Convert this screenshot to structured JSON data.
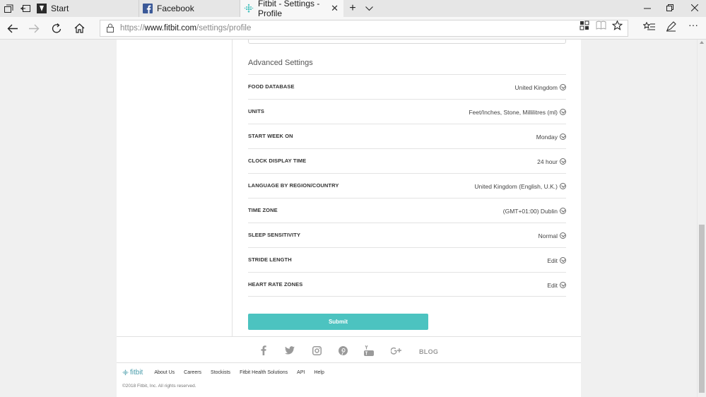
{
  "browser": {
    "tabs": [
      {
        "label": "Start",
        "icon": "start-icon"
      },
      {
        "label": "Facebook",
        "icon": "facebook-icon"
      },
      {
        "label": "Fitbit - Settings - Profile",
        "icon": "fitbit-icon",
        "active": true
      }
    ],
    "url": {
      "scheme": "https://",
      "host": "www.fitbit.com",
      "path": "/settings/profile"
    }
  },
  "section_title": "Advanced Settings",
  "settings": [
    {
      "label": "FOOD DATABASE",
      "value": "United Kingdom"
    },
    {
      "label": "UNITS",
      "value": "Feet/Inches, Stone, Millilitres (ml)"
    },
    {
      "label": "START WEEK ON",
      "value": "Monday"
    },
    {
      "label": "CLOCK DISPLAY TIME",
      "value": "24 hour"
    },
    {
      "label": "LANGUAGE BY REGION/COUNTRY",
      "value": "United Kingdom (English, U.K.)"
    },
    {
      "label": "TIME ZONE",
      "value": "(GMT+01:00) Dublin"
    },
    {
      "label": "SLEEP SENSITIVITY",
      "value": "Normal"
    },
    {
      "label": "STRIDE LENGTH",
      "value": "Edit"
    },
    {
      "label": "HEART RATE ZONES",
      "value": "Edit"
    }
  ],
  "submit_label": "Submit",
  "footer": {
    "social": [
      "facebook-icon",
      "twitter-icon",
      "instagram-icon",
      "pinterest-icon",
      "youtube-icon",
      "google-plus-icon"
    ],
    "blog_label": "BLOG",
    "logo_text": "fitbit",
    "links": [
      "About Us",
      "Careers",
      "Stockists",
      "Fitbit Health Solutions",
      "API",
      "Help"
    ],
    "copyright": "©2018 Fitbit, Inc. All rights reserved."
  },
  "colors": {
    "accent": "#4cc3c0",
    "facebook": "#3b5998",
    "fitbit_brand": "#4a9dab"
  }
}
